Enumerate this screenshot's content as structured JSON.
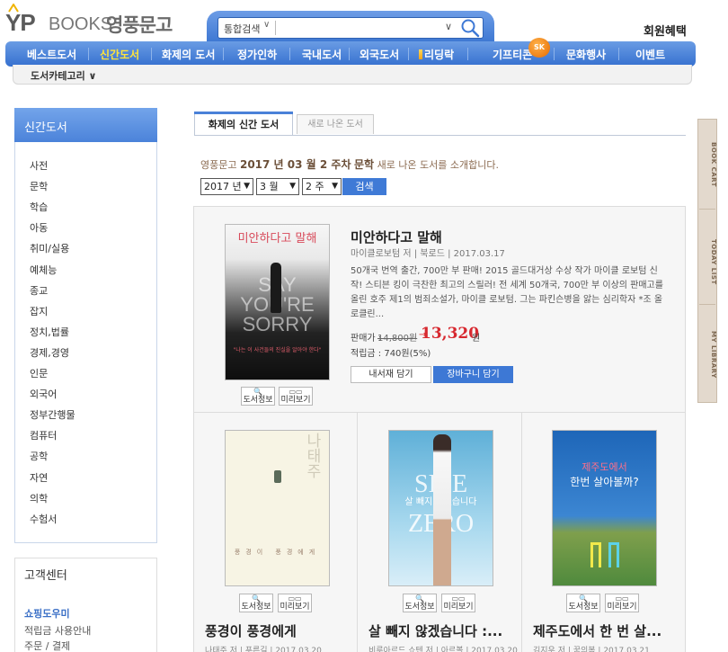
{
  "header": {
    "logo_en": "BOOKS",
    "logo_ko": "영풍문고",
    "search_scope": "통합검색",
    "search_placeholder": "",
    "member_benefit": "회원혜택"
  },
  "gnb": {
    "items": [
      {
        "label": "베스트도서"
      },
      {
        "label": "신간도서"
      },
      {
        "label": "화제의 도서"
      },
      {
        "label": "정가인하"
      },
      {
        "label": "국내도서"
      },
      {
        "label": "외국도서"
      },
      {
        "label": "리딩락"
      },
      {
        "label": "기프티콘"
      },
      {
        "label": "문화행사"
      },
      {
        "label": "이벤트"
      }
    ],
    "badge": "SK",
    "category_menu": "도서카테고리 ∨"
  },
  "sidebar": {
    "title": "신간도서",
    "items": [
      "사전",
      "문학",
      "학습",
      "아동",
      "취미/실용",
      "예체능",
      "종교",
      "잡지",
      "정치,법률",
      "경제,경영",
      "인문",
      "외국어",
      "정부간행물",
      "컴퓨터",
      "공학",
      "자연",
      "의학",
      "수험서"
    ],
    "cs_title": "고객센터",
    "cs_links": [
      "쇼핑도우미",
      "적립금 사용안내",
      "주문 / 결제"
    ]
  },
  "tabs": {
    "active": "화제의 신간 도서",
    "inactive": "새로 나온 도서"
  },
  "intro": {
    "prefix": "영풍문고",
    "week": "2017 년 03 월 2 주차",
    "genre": "문학",
    "suffix": "새로 나온 도서를 소개합니다."
  },
  "filters": {
    "year": "2017 년",
    "month": "3 월",
    "week": "2 주",
    "search_button": "검색"
  },
  "featured": {
    "title": "미안하다고 말해",
    "meta": "마이클로보텀 저 | 북로드 | 2017.03.17",
    "desc": "50개국 번역 출간, 700만 부 판매! 2015 골드대거상 수상 작가 마이클 로보텀 신작! 스티븐 킹이 극찬한 최고의 스릴러! 전 세계 50개국, 700만 부 이상의 판매고를 올린 호주 제1의 범죄소설가, 마이클 로보텀. 그는 파킨슨병을 앓는 심리학자 *조 올로클린...",
    "price_label": "판매가 :",
    "price_original": "14,800원",
    "price_arrow": "→",
    "price_sale": "13,320",
    "price_unit": "원",
    "point": "적립금 : 740원(5%)",
    "btn_shelf": "내서재 담기",
    "btn_cart": "장바구니 담기",
    "cover": {
      "title": "미안하다고 말해",
      "en": "SAY YOU'RE SORRY",
      "quote": "\"나는 이 사건들의 진실을 알아야 한다\""
    }
  },
  "mini_buttons": {
    "info": "도서정보",
    "preview": "미리보기"
  },
  "books": [
    {
      "title": "풍경이 풍경에게",
      "meta": "나태주 저 | 푸른길 | 2017.03.20",
      "cover_author": "나태주",
      "cover_title": "풍경이 풍경에게"
    },
    {
      "title": "살 빼지 않겠습니다 :...",
      "meta": "비루아르드 쇼텐 저 | 아르볼 | 2017.03.20",
      "cover_en1": "SIZE",
      "cover_en2": "ZERO",
      "cover_ko": "살 빼지 않겠습니다"
    },
    {
      "title": "제주도에서 한 번 살...",
      "meta": "김지우 저 | 꿈의봄 | 2017.03.21",
      "cover_line1": "제주도에서",
      "cover_line2": "한번 살아볼까?"
    }
  ],
  "rail": [
    "BOOK CART",
    "TODAY LIST",
    "MY LIBRARY"
  ],
  "colors": {
    "accent": "#3f7ad6",
    "sale": "#d7282f",
    "active_nav": "#ffe43a"
  }
}
